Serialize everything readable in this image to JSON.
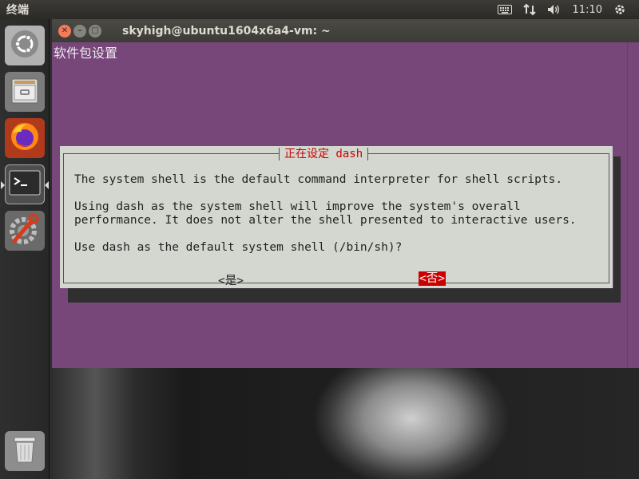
{
  "top_panel": {
    "app_title": "终端",
    "time": "11:10",
    "icons": [
      "keyboard-icon",
      "network-icon",
      "volume-icon",
      "settings-gear-icon"
    ]
  },
  "launcher": {
    "items": [
      {
        "name": "ubuntu-dash",
        "icon": "ubuntu-logo-icon"
      },
      {
        "name": "files",
        "icon": "files-icon"
      },
      {
        "name": "firefox",
        "icon": "firefox-icon"
      },
      {
        "name": "terminal",
        "icon": "terminal-icon",
        "active": true
      },
      {
        "name": "system-settings",
        "icon": "settings-icon"
      },
      {
        "name": "trash",
        "icon": "trash-icon"
      }
    ]
  },
  "window": {
    "title": "skyhigh@ubuntu1604x6a4-vm: ~",
    "close_glyph": "✕",
    "min_glyph": "–",
    "max_glyph": "□"
  },
  "terminal": {
    "header": "软件包设置",
    "background": "#77477a"
  },
  "dialog": {
    "title": "正在设定 dash",
    "lines": [
      "The system shell is the default command interpreter for shell scripts.",
      "Using dash as the system shell will improve the system's overall",
      "performance. It does not alter the shell presented to interactive users.",
      "Use dash as the default system shell (/bin/sh)?"
    ],
    "yes_label": "<是>",
    "no_label": "<否>",
    "selected": "no",
    "accent": "#cc0000"
  }
}
